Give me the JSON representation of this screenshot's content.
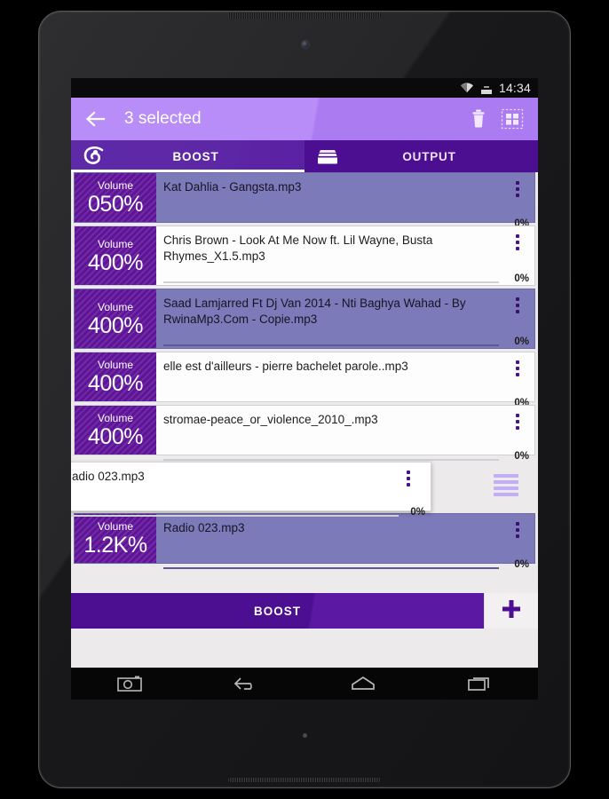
{
  "status_bar": {
    "time": "14:34",
    "wifi_icon": "wifi-icon",
    "battery_icon": "battery-icon"
  },
  "app_bar": {
    "back_icon": "back-arrow-icon",
    "title": "3 selected",
    "delete_icon": "trash-icon",
    "select_all_icon": "grid-select-icon"
  },
  "tabs": [
    {
      "label": "BOOST",
      "icon": "boost-swirl-icon",
      "active": true
    },
    {
      "label": "OUTPUT",
      "icon": "output-drawer-icon",
      "active": false
    }
  ],
  "colors": {
    "app_bar": "#b88df7",
    "tab_bar": "#4c0f92",
    "volume_badge": "#5e1398",
    "row_selected": "#7d7ab9",
    "row_unselected": "#fdfdfd",
    "list_background": "#eceaea",
    "accent": "#4a1090"
  },
  "list": {
    "overflow_icon": "more-vertical-icon",
    "volume_label": "Volume",
    "rows": [
      {
        "volume": "050%",
        "title": "Kat Dahlia - Gangsta.mp3",
        "progress": "0%",
        "selected": true
      },
      {
        "volume": "400%",
        "title": "Chris Brown - Look At Me Now ft. Lil Wayne, Busta Rhymes_X1.5.mp3",
        "progress": "0%",
        "selected": false
      },
      {
        "volume": "400%",
        "title": "Saad Lamjarred Ft Dj Van 2014 - Nti Baghya Wahad - By RwinaMp3.Com - Copie.mp3",
        "progress": "0%",
        "selected": true
      },
      {
        "volume": "400%",
        "title": "elle est d'ailleurs - pierre bachelet parole..mp3",
        "progress": "0%",
        "selected": false
      },
      {
        "volume": "400%",
        "title": "stromae-peace_or_violence_2010_.mp3",
        "progress": "0%",
        "selected": false
      }
    ],
    "dragging_row": {
      "title": "adio 023.mp3",
      "progress": "0%",
      "drag_handle_icon": "drag-handle-icon"
    },
    "last_row": {
      "volume": "1.2K%",
      "title": "Radio 023.mp3",
      "progress": "0%",
      "selected": true
    }
  },
  "bottom_bar": {
    "boost_label": "BOOST",
    "add_icon": "plus-icon"
  },
  "nav_bar": {
    "screenshot_icon": "camera-icon",
    "back_icon": "nav-back-icon",
    "home_icon": "nav-home-icon",
    "recents_icon": "nav-recents-icon"
  }
}
